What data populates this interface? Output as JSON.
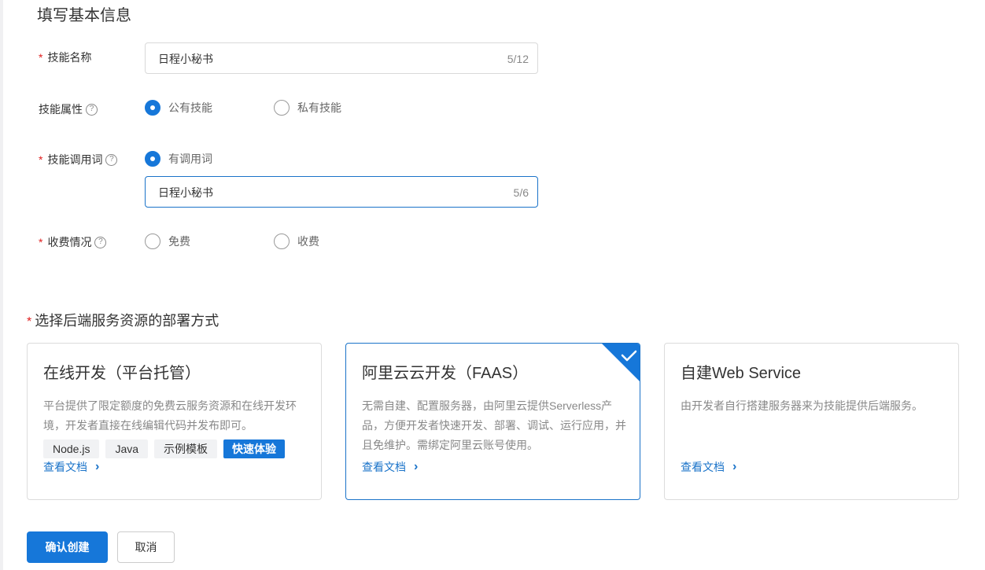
{
  "basic_info": {
    "title": "填写基本信息",
    "skill_name": {
      "label": "技能名称",
      "value": "日程小秘书",
      "count": "5/12"
    },
    "skill_property": {
      "label": "技能属性",
      "options": [
        "公有技能",
        "私有技能"
      ],
      "selected": "公有技能"
    },
    "invocation": {
      "label": "技能调用词",
      "option": "有调用词",
      "value": "日程小秘书",
      "count": "5/6"
    },
    "fee": {
      "label": "收费情况",
      "options": [
        "免费",
        "收费"
      ]
    }
  },
  "deploy": {
    "title": "选择后端服务资源的部署方式",
    "cards": [
      {
        "title": "在线开发（平台托管）",
        "desc": "平台提供了限定额度的免费云服务资源和在线开发环境，开发者直接在线编辑代码并发布即可。",
        "tags": [
          "Node.js",
          "Java",
          "示例模板"
        ],
        "quick_tag": "快速体验",
        "link": "查看文档"
      },
      {
        "title": "阿里云云开发（FAAS）",
        "desc": "无需自建、配置服务器，由阿里云提供Serverless产品，方便开发者快速开发、部署、调试、运行应用，并且免维护。需绑定阿里云账号使用。",
        "link": "查看文档",
        "selected": true
      },
      {
        "title": "自建Web Service",
        "desc": "由开发者自行搭建服务器来为技能提供后端服务。",
        "link": "查看文档"
      }
    ]
  },
  "actions": {
    "confirm": "确认创建",
    "cancel": "取消"
  },
  "colors": {
    "primary": "#1677d9",
    "required": "#e02020",
    "selected_border": "#1a73c9"
  },
  "icons": {
    "help": "question-circle-icon",
    "chevron": "chevron-right-icon",
    "check": "check-icon"
  }
}
